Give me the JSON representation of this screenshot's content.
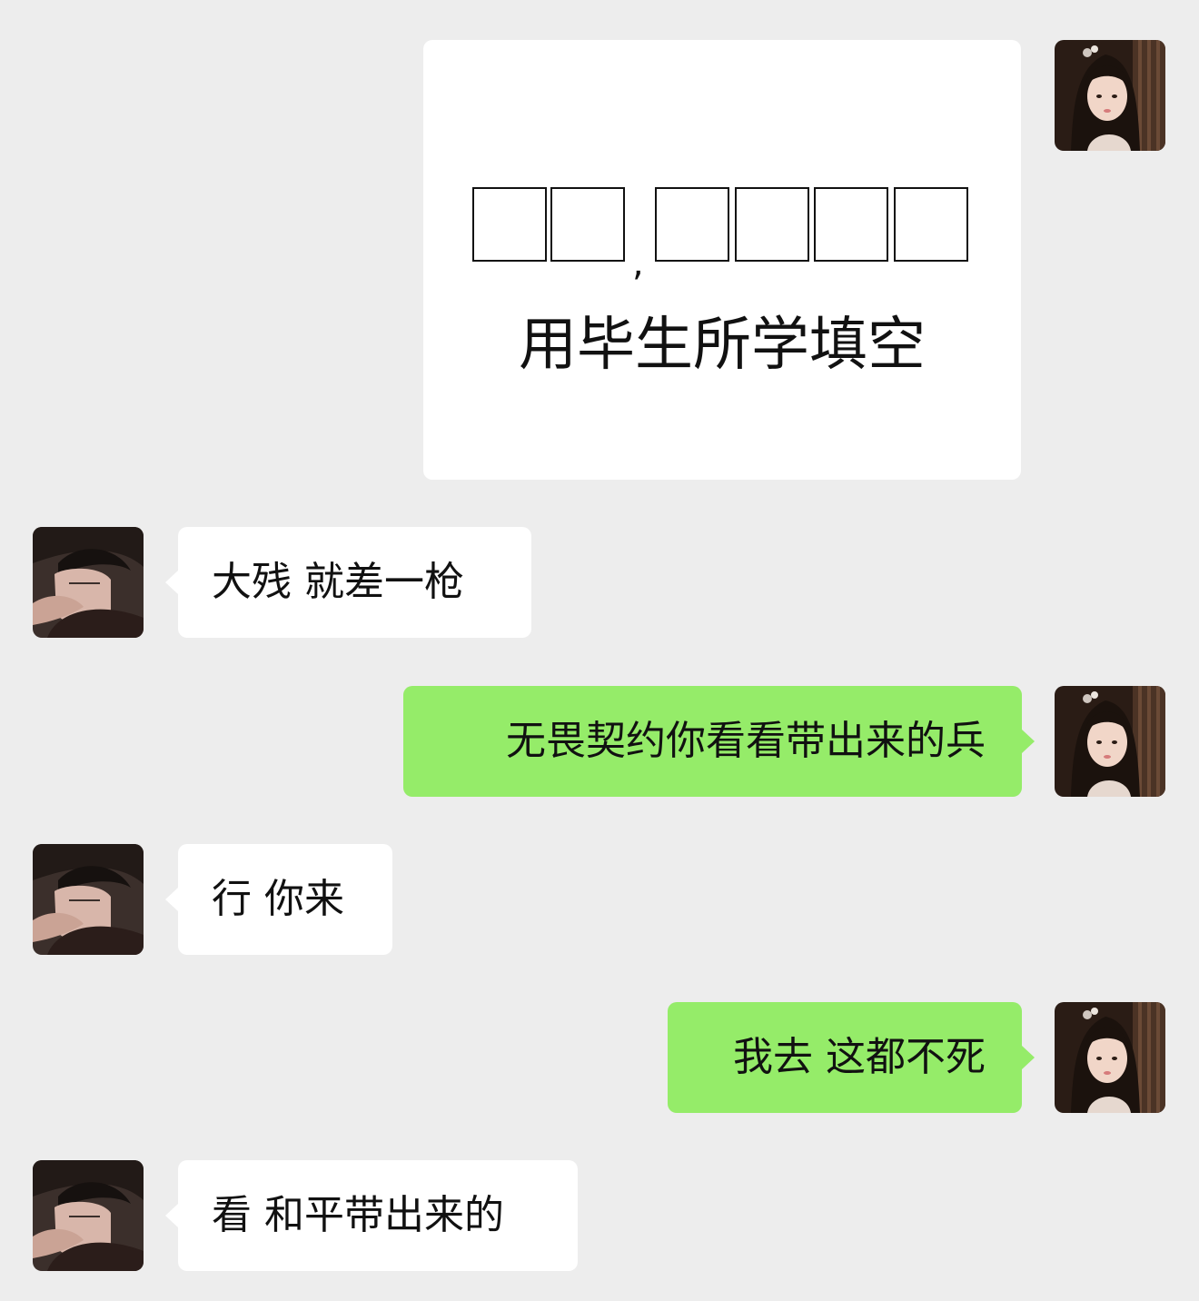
{
  "messages": [
    {
      "from": "me",
      "type": "image",
      "caption": "用毕生所学填空",
      "separator": ","
    },
    {
      "from": "friend",
      "type": "text",
      "text": "大残 就差一枪"
    },
    {
      "from": "me",
      "type": "text",
      "text": "无畏契约你看看带出来的兵"
    },
    {
      "from": "friend",
      "type": "text",
      "text": "行 你来"
    },
    {
      "from": "me",
      "type": "text",
      "text": "我去 这都不死"
    },
    {
      "from": "friend",
      "type": "text",
      "text": "看 和平带出来的"
    }
  ],
  "colors": {
    "background": "#ededed",
    "incoming_bubble": "#ffffff",
    "outgoing_bubble": "#95ec69",
    "text": "#111111"
  },
  "icons": {
    "my_avatar": "avatar-girl-icon",
    "friend_avatar": "avatar-boy-icon"
  }
}
